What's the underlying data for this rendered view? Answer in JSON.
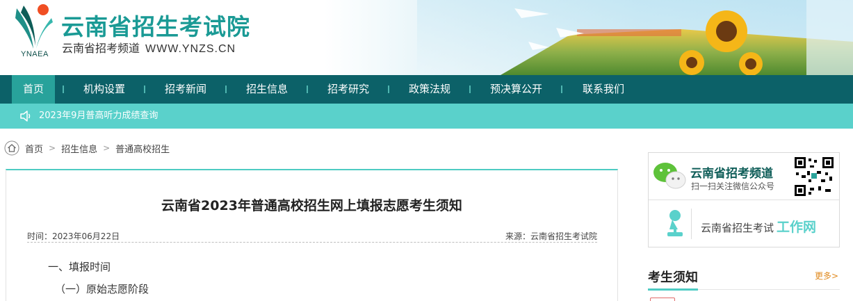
{
  "header": {
    "logo_text": "YNAEA",
    "title": "云南省招生考试院",
    "subtitle": "云南省招考频道",
    "url": "WWW.YNZS.CN"
  },
  "nav": {
    "items": [
      {
        "label": "首页",
        "active": true
      },
      {
        "label": "机构设置"
      },
      {
        "label": "招考新闻"
      },
      {
        "label": "招生信息"
      },
      {
        "label": "招考研究"
      },
      {
        "label": "政策法规"
      },
      {
        "label": "预决算公开"
      },
      {
        "label": "联系我们"
      }
    ]
  },
  "notice": {
    "icon": "speaker-icon",
    "text": "2023年9月普高听力成绩查询"
  },
  "breadcrumb": {
    "items": [
      "首页",
      "招生信息",
      "普通高校招生"
    ],
    "separator": ">"
  },
  "article": {
    "title": "云南省2023年普通高校招生网上填报志愿考生须知",
    "date": "时间：2023年06月22日",
    "source": "来源：云南省招生考试院",
    "p1": "一、填报时间",
    "p2": "（一）原始志愿阶段"
  },
  "sidebar": {
    "wechat_title": "云南省招考频道",
    "wechat_sub": "扫一扫关注微信公众号",
    "work_prefix": "云南省招生考试",
    "work_accent": "工作网",
    "section_title": "考生须知",
    "more": "更多>"
  },
  "colors": {
    "nav_bg": "#0c6168",
    "nav_active": "#28a29b",
    "notice_bg": "#5ad1cb",
    "accent": "#4ecbc3",
    "title_teal": "#1a9a95"
  }
}
